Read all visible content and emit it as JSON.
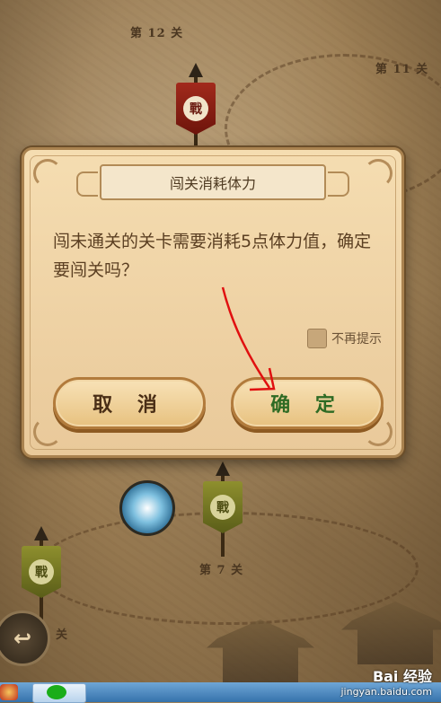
{
  "map": {
    "level_top": "第 12 关",
    "level_right": "第 11 关",
    "level_bottom": "第 7 关",
    "banner_glyph": "戰",
    "back_arrow": "↩",
    "edge_text": "关"
  },
  "dialog": {
    "title": "闯关消耗体力",
    "message": "闯未通关的关卡需要消耗5点体力值，确定要闯关吗？",
    "dont_remind_label": "不再提示",
    "cancel_label": "取 消",
    "confirm_label": "确 定"
  },
  "taskbar": {
    "icons": [
      "red-app-icon",
      "wechat-icon"
    ]
  },
  "watermark": {
    "brand": "Bai 经验",
    "site": "jingyan.baidu.com"
  },
  "colors": {
    "dialog_bg": "#f0d4a6",
    "confirm_text": "#2e6b24",
    "cancel_text": "#4a2e16",
    "annotation_arrow": "#e01010"
  }
}
